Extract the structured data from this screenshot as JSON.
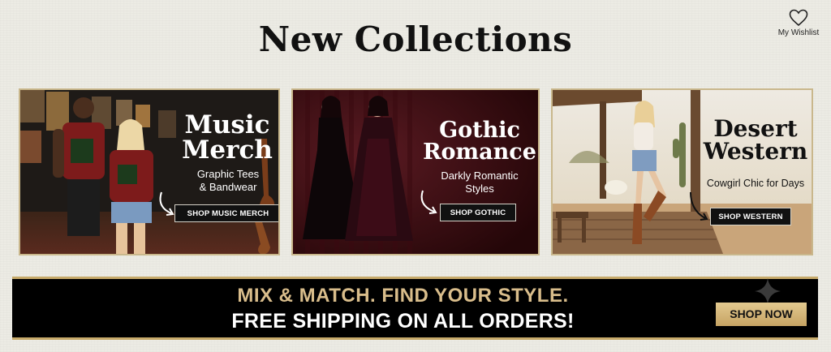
{
  "page": {
    "title": "New Collections"
  },
  "wishlist": {
    "label": "My Wishlist",
    "icon": "heart-icon"
  },
  "collections": [
    {
      "heading_line1": "Music",
      "heading_line2": "Merch",
      "sub_line1": "Graphic Tees",
      "sub_line2": "& Bandwear",
      "button": "SHOP MUSIC MERCH"
    },
    {
      "heading_line1": "Gothic",
      "heading_line2": "Romance",
      "sub_line1": "Darkly Romantic",
      "sub_line2": "Styles",
      "button": "SHOP GOTHIC"
    },
    {
      "heading_line1": "Desert",
      "heading_line2": "Western",
      "sub_line1": "Cowgirl Chic for Days",
      "button": "SHOP WESTERN"
    }
  ],
  "promo": {
    "line1": "MIX & MATCH. FIND YOUR STYLE.",
    "line2": "FREE SHIPPING ON ALL ORDERS!",
    "button": "SHOP NOW"
  },
  "colors": {
    "background": "#ecebe4",
    "gold_accent": "#c7aa6a",
    "gold_text": "#d9bd8b",
    "banner": "#000000"
  }
}
